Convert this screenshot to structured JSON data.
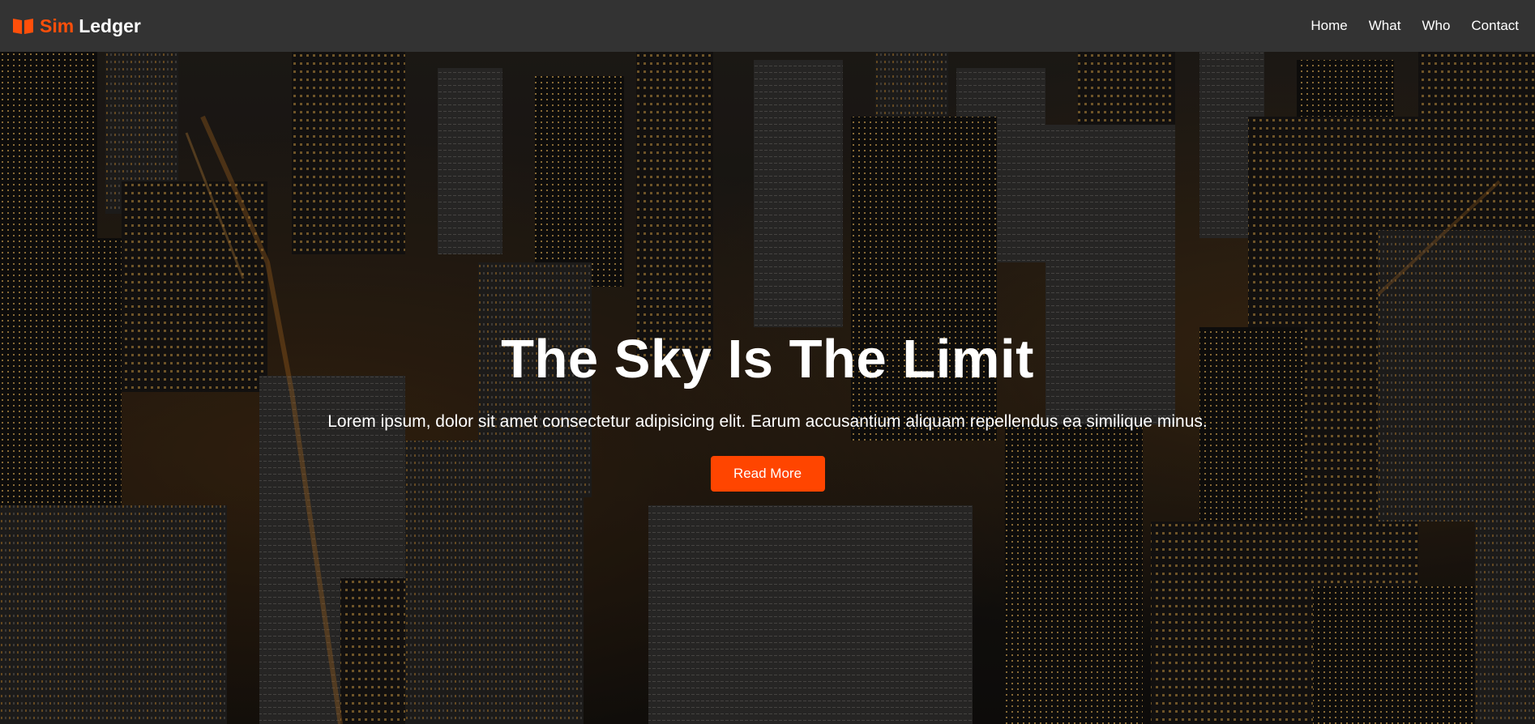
{
  "brand": {
    "accent_text": "Sim",
    "text": "Ledger",
    "icon": "book-icon",
    "accent_color": "#ff4f0a"
  },
  "nav": {
    "items": [
      {
        "label": "Home"
      },
      {
        "label": "What"
      },
      {
        "label": "Who"
      },
      {
        "label": "Contact"
      }
    ]
  },
  "hero": {
    "title": "The Sky Is The Limit",
    "text": "Lorem ipsum, dolor sit amet consectetur adipisicing elit. Earum accusantium aliquam repellendus ea similique minus.",
    "button_label": "Read More",
    "button_color": "#ff4500",
    "background": "aerial city skyline at night"
  }
}
